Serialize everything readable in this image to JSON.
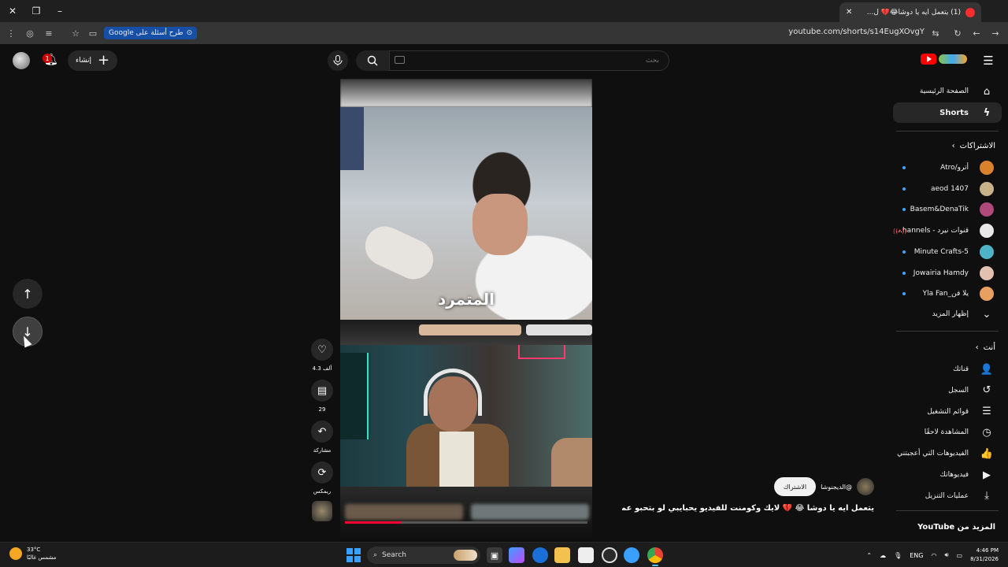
{
  "browser": {
    "tab_title": "(1) يتعمل ايه يا دوشا😂💔 ل...",
    "url": "youtube.com/shorts/s14EugXOvgY",
    "google_chip": "طرح أسئلة على Google"
  },
  "header": {
    "create_label": "إنشاء",
    "notif_count": "1",
    "search_placeholder": "بحث"
  },
  "sidebar": {
    "home": "الصفحة الرئيسية",
    "shorts": "Shorts",
    "subs_heading": "الاشتراكات",
    "channels": [
      {
        "name": "أترو/Atro",
        "color": "#d9822b",
        "new": true
      },
      {
        "name": "aeod 1407",
        "color": "#c8b28a",
        "new": true
      },
      {
        "name": "Basem&DenaTik",
        "color": "#b04a7a",
        "new": true
      },
      {
        "name": "قنوات نيرد - hannels...",
        "color": "#e8e8e8",
        "new": false,
        "live": true
      },
      {
        "name": "5-Minute Crafts",
        "color": "#4fb3c8",
        "new": true
      },
      {
        "name": "Jowairia Hamdy",
        "color": "#e3c1b0",
        "new": true
      },
      {
        "name": "يلا فن_Yla Fan",
        "color": "#e8a060",
        "new": true
      }
    ],
    "show_more": "إظهار المزيد",
    "you_heading": "أنت",
    "you_items": [
      {
        "label": "قناتك",
        "icon": "👤"
      },
      {
        "label": "السجل",
        "icon": "↺"
      },
      {
        "label": "قوائم التشغيل",
        "icon": "☰"
      },
      {
        "label": "المشاهدة لاحقًا",
        "icon": "◷"
      },
      {
        "label": "الفيديوهات التي أعجبتني",
        "icon": "👍"
      },
      {
        "label": "فيديوهاتك",
        "icon": "▶"
      },
      {
        "label": "عمليات التنزيل",
        "icon": "⤓"
      }
    ],
    "more_from": "المزيد من YouTube"
  },
  "short": {
    "caption": "المتمرد",
    "channel": "@الديجنوشا",
    "subscribe": "الاشتراك",
    "title": "يتعمل ايه يا دوشا 😂 💔 لايك وكومنت للفيديو يحبايبي لو بتحبو عمر ...",
    "progress": 0.23,
    "likes": "4.3 ألف",
    "comments": "29",
    "share": "مشاركة",
    "remix": "ريمكس"
  },
  "taskbar": {
    "weather_temp": "33°C",
    "weather_desc": "مشمس غالبًا",
    "search": "Search",
    "lang": "ENG",
    "time": "4:46 PM",
    "date": "8/31/2026"
  }
}
